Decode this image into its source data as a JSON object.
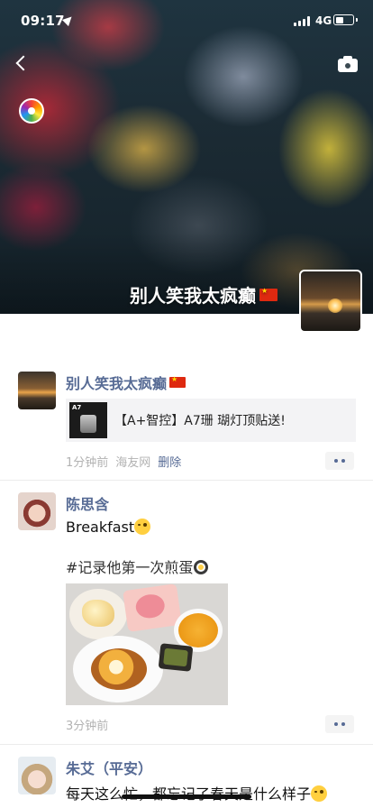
{
  "status_bar": {
    "time": "09:17",
    "network": "4G",
    "battery_level": 0.4
  },
  "header": {
    "back_icon": "chevron-left-icon",
    "camera_icon": "camera-icon",
    "cover_name": "别人笑我太疯癫",
    "cover_flag": "china-flag-icon"
  },
  "posts": [
    {
      "name": "别人笑我太疯癫",
      "link_card": {
        "thumb_label": "A7",
        "title": "【A+智控】A7珊 瑚灯顶贴送!"
      },
      "time": "1分钟前",
      "source": "海友网",
      "delete_label": "删除"
    },
    {
      "name": "陈思含",
      "text": "Breakfast",
      "topic": "#记录他第一次煎蛋",
      "time": "3分钟前"
    },
    {
      "name": "朱艾（平安）",
      "text": "每天这么忙，都忘记了春天是什么样子"
    }
  ],
  "colors": {
    "link_blue": "#576b95",
    "meta_gray": "#b2b2b2",
    "divider": "#ececec"
  }
}
